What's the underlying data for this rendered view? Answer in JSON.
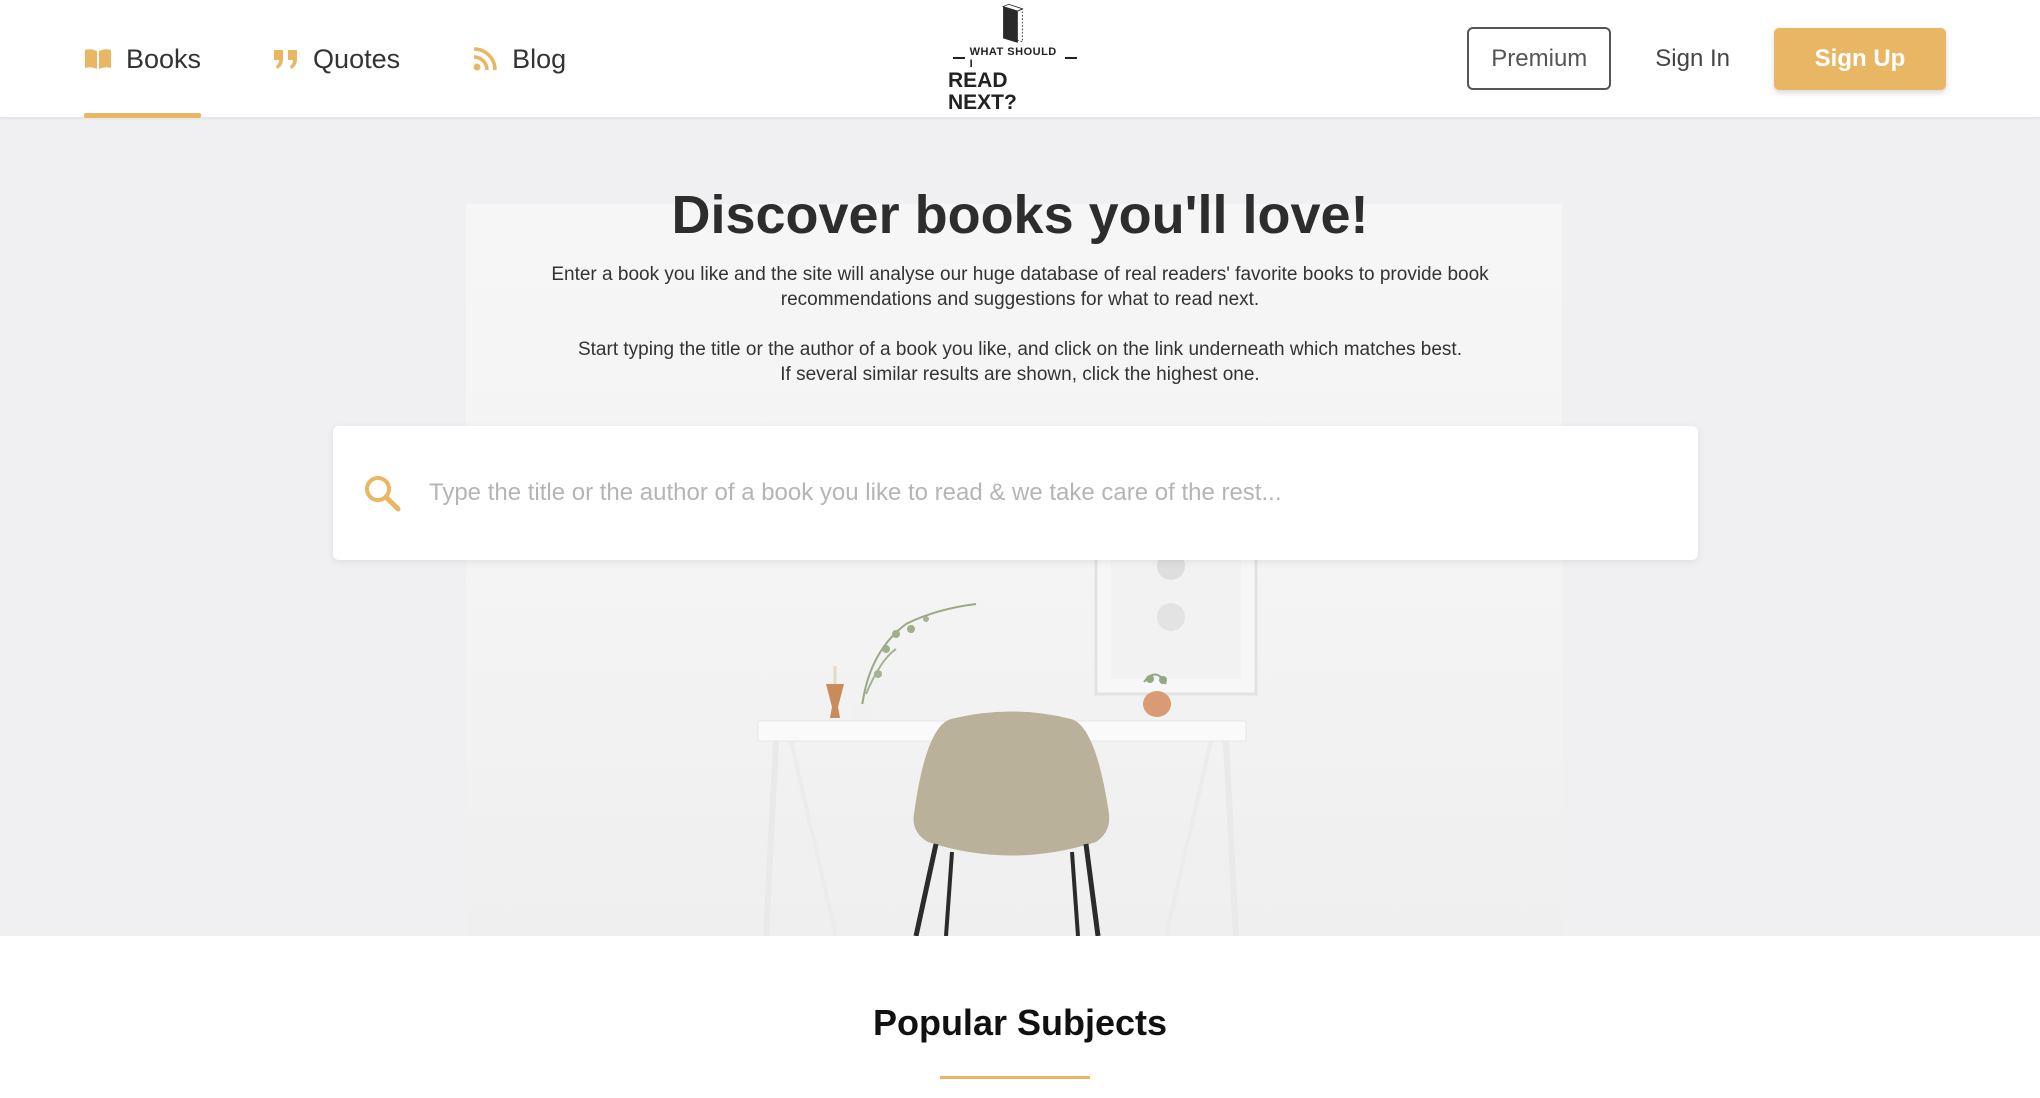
{
  "header": {
    "nav": [
      {
        "label": "Books",
        "icon": "open-book-icon",
        "active": true
      },
      {
        "label": "Quotes",
        "icon": "quote-icon",
        "active": false
      },
      {
        "label": "Blog",
        "icon": "rss-icon",
        "active": false
      }
    ],
    "logo": {
      "line1": "WHAT SHOULD I",
      "line2": "READ NEXT?"
    },
    "premium_label": "Premium",
    "signin_label": "Sign In",
    "signup_label": "Sign Up"
  },
  "hero": {
    "title": "Discover books you'll love!",
    "intro_line1": "Enter a book you like and the site will analyse our huge database of real readers' favorite books to provide book",
    "intro_line2": "recommendations and suggestions for what to read next.",
    "instr_line1": "Start typing the title or the author of a book you like, and click on the link underneath which matches best.",
    "instr_line2": "If several similar results are shown, click the highest one.",
    "search_placeholder": "Type the title or the author of a book you like to read & we take care of the rest..."
  },
  "popular": {
    "title": "Popular Subjects"
  },
  "colors": {
    "accent": "#e9b663",
    "hero_bg": "#f0f0f2",
    "text_dark": "#2d2d2d"
  }
}
